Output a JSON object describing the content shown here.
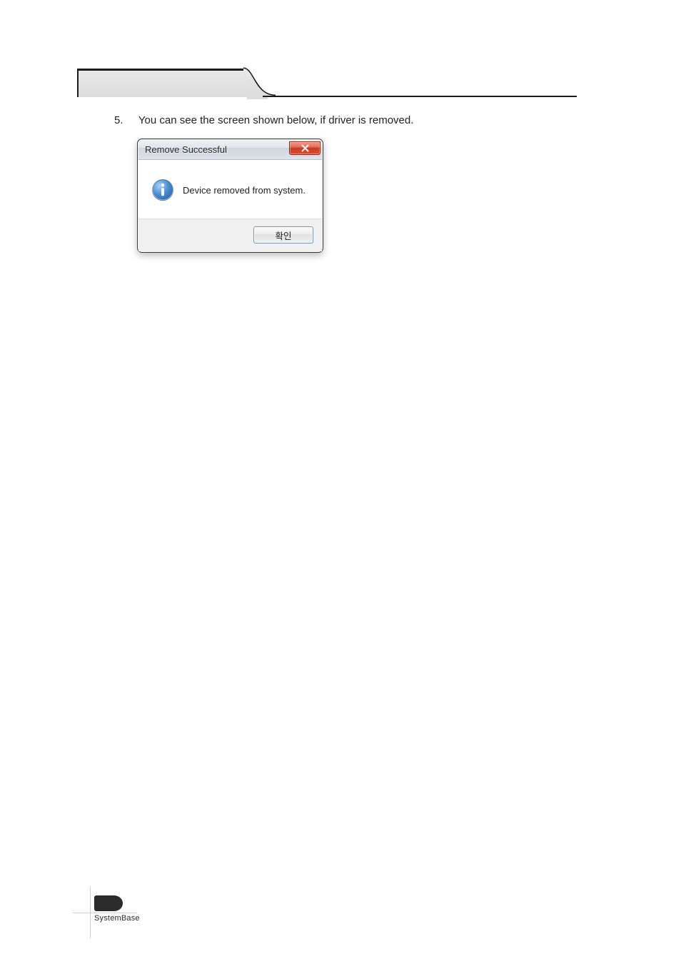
{
  "instruction": {
    "number": "5.",
    "text": "You can see the screen shown below, if driver is removed."
  },
  "dialog": {
    "title": "Remove Successful",
    "message": "Device removed from system.",
    "ok_label": "확인"
  },
  "footer": {
    "brand": "SystemBase"
  }
}
